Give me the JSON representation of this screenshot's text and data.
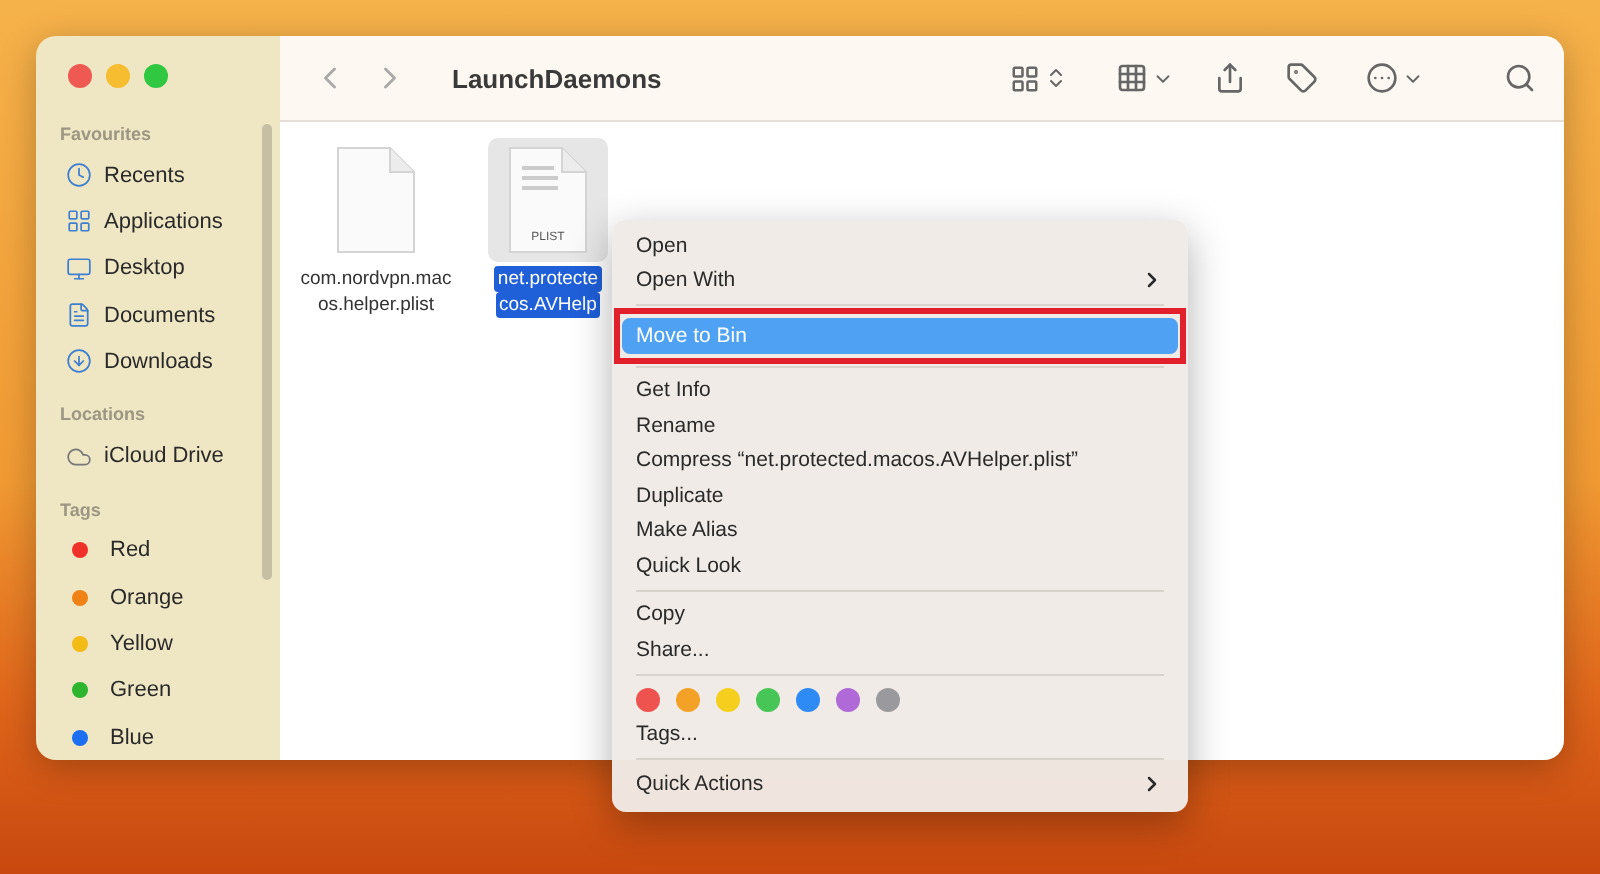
{
  "window": {
    "title": "LaunchDaemons"
  },
  "sidebar": {
    "sections": [
      {
        "heading": "Favourites",
        "items": [
          {
            "label": "Recents"
          },
          {
            "label": "Applications"
          },
          {
            "label": "Desktop"
          },
          {
            "label": "Documents"
          },
          {
            "label": "Downloads"
          }
        ]
      },
      {
        "heading": "Locations",
        "items": [
          {
            "label": "iCloud Drive"
          }
        ]
      },
      {
        "heading": "Tags",
        "items": [
          {
            "label": "Red",
            "color": "#f0302a"
          },
          {
            "label": "Orange",
            "color": "#ee8217"
          },
          {
            "label": "Yellow",
            "color": "#f2bb16"
          },
          {
            "label": "Green",
            "color": "#2db52d"
          },
          {
            "label": "Blue",
            "color": "#1b6ff0"
          }
        ]
      }
    ]
  },
  "files": [
    {
      "name_lines": [
        "com.nordvpn.mac",
        "os.helper.plist"
      ],
      "selected": false
    },
    {
      "name_lines": [
        "net.protecte",
        "cos.AVHelp"
      ],
      "icon_label": "PLIST",
      "selected": true
    }
  ],
  "context_menu": {
    "items": [
      {
        "kind": "item",
        "label": "Open",
        "submenu": false,
        "selected": false
      },
      {
        "kind": "item",
        "label": "Open With",
        "submenu": true,
        "selected": false
      },
      {
        "kind": "separator"
      },
      {
        "kind": "item",
        "label": "Move to Bin",
        "submenu": false,
        "selected": true,
        "outlined": true
      },
      {
        "kind": "separator"
      },
      {
        "kind": "item",
        "label": "Get Info",
        "submenu": false,
        "selected": false
      },
      {
        "kind": "item",
        "label": "Rename",
        "submenu": false,
        "selected": false
      },
      {
        "kind": "item",
        "label": "Compress “net.protected.macos.AVHelper.plist”",
        "submenu": false,
        "selected": false
      },
      {
        "kind": "item",
        "label": "Duplicate",
        "submenu": false,
        "selected": false
      },
      {
        "kind": "item",
        "label": "Make Alias",
        "submenu": false,
        "selected": false
      },
      {
        "kind": "item",
        "label": "Quick Look",
        "submenu": false,
        "selected": false
      },
      {
        "kind": "separator"
      },
      {
        "kind": "item",
        "label": "Copy",
        "submenu": false,
        "selected": false
      },
      {
        "kind": "item",
        "label": "Share...",
        "submenu": false,
        "selected": false
      },
      {
        "kind": "separator"
      },
      {
        "kind": "tags",
        "tags": [
          {
            "color": "#ee5350"
          },
          {
            "color": "#f4a127"
          },
          {
            "color": "#f6cf1e"
          },
          {
            "color": "#48c557"
          },
          {
            "color": "#2e8bf5"
          },
          {
            "color": "#b06ad7"
          },
          {
            "color": "#9a9a9e"
          }
        ]
      },
      {
        "kind": "item",
        "label": "Tags...",
        "submenu": false,
        "selected": false
      },
      {
        "kind": "separator"
      },
      {
        "kind": "item",
        "label": "Quick Actions",
        "submenu": true,
        "selected": false
      }
    ]
  }
}
